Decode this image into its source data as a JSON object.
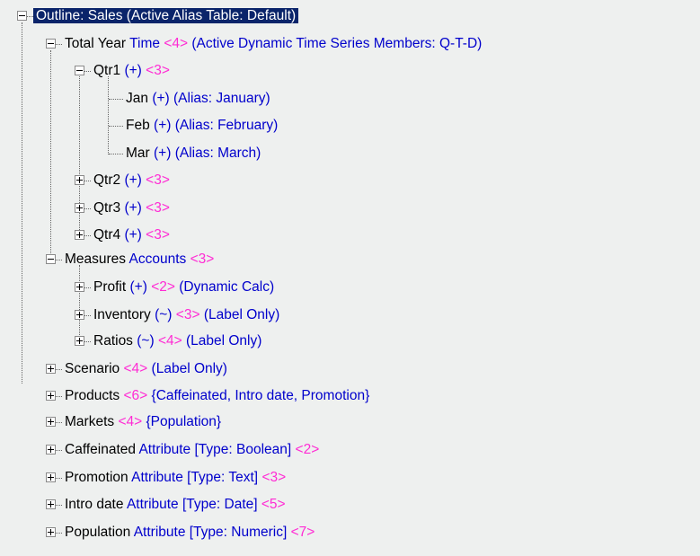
{
  "root": {
    "label": "Outline: Sales (Active Alias Table: Default)"
  },
  "dimensions": [
    {
      "name": "Total Year",
      "kw": "Time",
      "lvl": "<4>",
      "extra": "(Active Dynamic Time Series Members: Q-T-D)"
    },
    {
      "name": "Measures",
      "kw": "Accounts",
      "lvl": "<3>",
      "extra": ""
    },
    {
      "name": "Scenario",
      "kw": "",
      "lvl": "<4>",
      "extra": "(Label Only)"
    },
    {
      "name": "Products",
      "kw": "",
      "lvl": "<6>",
      "extra": "{Caffeinated, Intro date, Promotion}"
    },
    {
      "name": "Markets",
      "kw": "",
      "lvl": "<4>",
      "extra": "{Population}"
    },
    {
      "name": "Caffeinated",
      "kw": "Attribute [Type: Boolean]",
      "lvl": "<2>",
      "extra": ""
    },
    {
      "name": "Promotion",
      "kw": "Attribute [Type: Text]",
      "lvl": "<3>",
      "extra": ""
    },
    {
      "name": "Intro date",
      "kw": "Attribute [Type: Date]",
      "lvl": "<5>",
      "extra": ""
    },
    {
      "name": "Population",
      "kw": "Attribute [Type: Numeric]",
      "lvl": "<7>",
      "extra": ""
    }
  ],
  "time_members": [
    {
      "name": "Qtr1",
      "kw": "(+)",
      "lvl": "<3>",
      "extra": ""
    },
    {
      "name": "Jan",
      "kw": "(+) (Alias: January)",
      "lvl": "",
      "extra": ""
    },
    {
      "name": "Feb",
      "kw": "(+) (Alias: February)",
      "lvl": "",
      "extra": ""
    },
    {
      "name": "Mar",
      "kw": "(+) (Alias: March)",
      "lvl": "",
      "extra": ""
    },
    {
      "name": "Qtr2",
      "kw": "(+)",
      "lvl": "<3>",
      "extra": ""
    },
    {
      "name": "Qtr3",
      "kw": "(+)",
      "lvl": "<3>",
      "extra": ""
    },
    {
      "name": "Qtr4",
      "kw": "(+)",
      "lvl": "<3>",
      "extra": ""
    }
  ],
  "measures_members": [
    {
      "name": "Profit",
      "kw": "(+)",
      "lvl": "<2>",
      "extra": "(Dynamic Calc)"
    },
    {
      "name": "Inventory",
      "kw": "(~)",
      "lvl": "<3>",
      "extra": "(Label Only)"
    },
    {
      "name": "Ratios",
      "kw": "(~)",
      "lvl": "<4>",
      "extra": "(Label Only)"
    }
  ]
}
